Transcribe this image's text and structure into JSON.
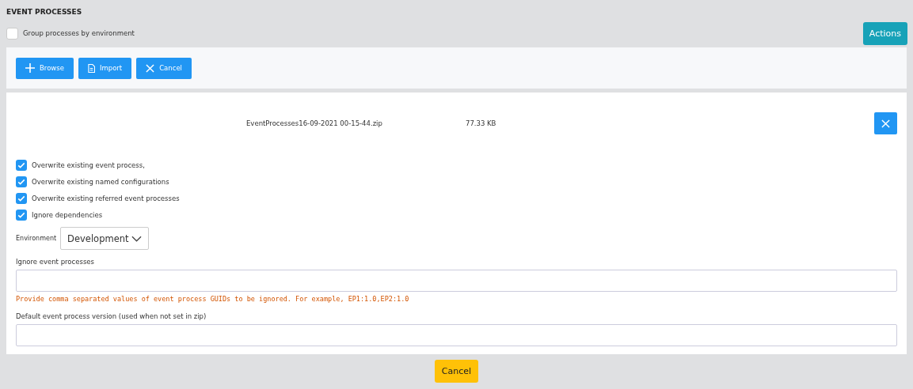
{
  "title": "EVENT PROCESSES",
  "group_by_environment": {
    "label": "Group processes by environment",
    "checked": false
  },
  "actions_button": "Actions",
  "toolbar": [
    {
      "label": "Browse",
      "kind": "plus"
    },
    {
      "label": "Import",
      "kind": "file"
    },
    {
      "label": "Cancel",
      "kind": "close"
    }
  ],
  "file": {
    "name": "EventProcesses16-09-2021 00-15-44.zip",
    "size": "77.33 KB"
  },
  "options": [
    {
      "label": "Overwrite existing event process,",
      "checked": true
    },
    {
      "label": "Overwrite existing named configurations",
      "checked": true
    },
    {
      "label": "Overwrite existing referred event processes",
      "checked": true
    },
    {
      "label": "Ignore dependencies",
      "checked": true
    }
  ],
  "environment": {
    "label": "Environment",
    "value": "Development"
  },
  "ignore_field": {
    "label": "Ignore event processes",
    "hint": "Provide comma separated values of event process GUIDs to be ignored. For example, EP1:1.0,EP2:1.0"
  },
  "version_field": {
    "label": "Default event process version (used when not set in zip)"
  },
  "footer_button": "Cancel"
}
